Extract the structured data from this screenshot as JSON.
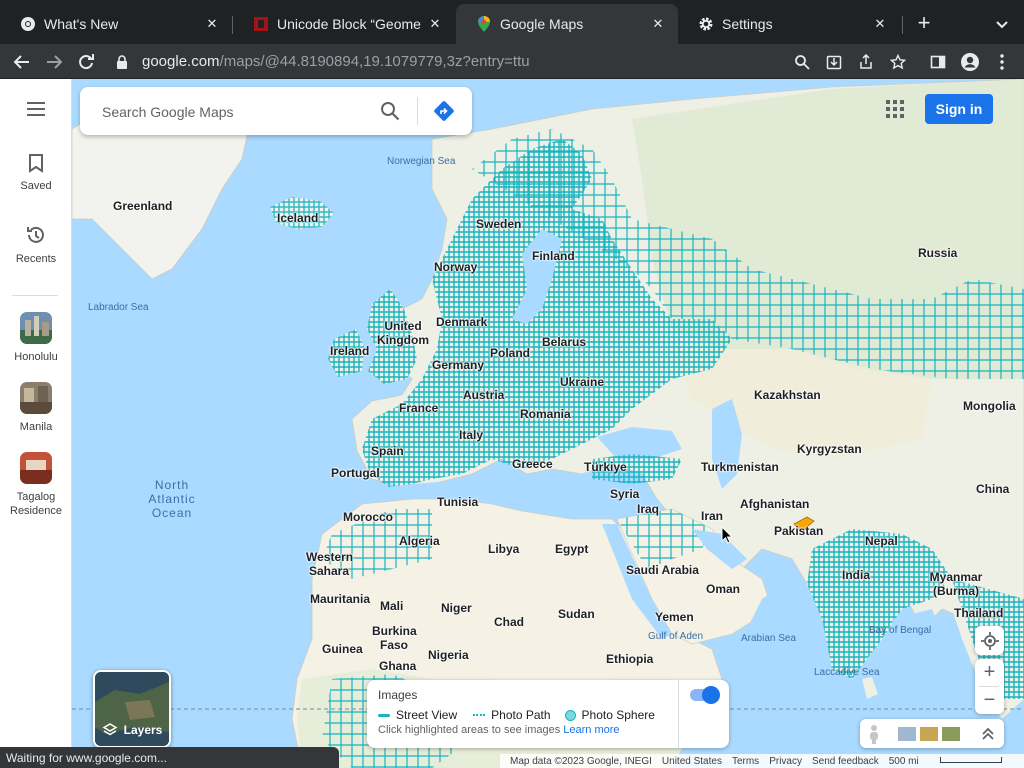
{
  "browser": {
    "tabs": [
      {
        "title": "What's New",
        "icon": "chrome-icon"
      },
      {
        "title": "Unicode Block “Geometric S",
        "icon": "unicode-site-icon"
      },
      {
        "title": "Google Maps",
        "icon": "google-maps-icon"
      },
      {
        "title": "Settings",
        "icon": "gear-icon"
      }
    ],
    "active_tab": 2,
    "url_host": "google.com",
    "url_path": "/maps/@44.8190894,19.1079779,3z?entry=ttu",
    "status_text": "Waiting for www.google.com..."
  },
  "rail": {
    "saved_label": "Saved",
    "recents_label": "Recents",
    "places": [
      {
        "label": "Honolulu"
      },
      {
        "label": "Manila"
      },
      {
        "label": "Tagalog Residence"
      }
    ]
  },
  "search": {
    "placeholder": "Search Google Maps"
  },
  "header": {
    "sign_in": "Sign in"
  },
  "map": {
    "labels": [
      {
        "text": "Greenland"
      },
      {
        "text": "Iceland"
      },
      {
        "text": "Sweden"
      },
      {
        "text": "Finland"
      },
      {
        "text": "Norway"
      },
      {
        "text": "Russia"
      },
      {
        "text": "Denmark"
      },
      {
        "text": "United Kingdom"
      },
      {
        "text": "Ireland"
      },
      {
        "text": "Poland"
      },
      {
        "text": "Belarus"
      },
      {
        "text": "Germany"
      },
      {
        "text": "Ukraine"
      },
      {
        "text": "France"
      },
      {
        "text": "Austria"
      },
      {
        "text": "Kazakhstan"
      },
      {
        "text": "Mongolia"
      },
      {
        "text": "Romania"
      },
      {
        "text": "Spain"
      },
      {
        "text": "Italy"
      },
      {
        "text": "Kyrgyzstan"
      },
      {
        "text": "Portugal"
      },
      {
        "text": "Greece"
      },
      {
        "text": "Türkiye"
      },
      {
        "text": "Turkmenistan"
      },
      {
        "text": "China"
      },
      {
        "text": "Tunisia"
      },
      {
        "text": "Syria"
      },
      {
        "text": "Afghanistan"
      },
      {
        "text": "Morocco"
      },
      {
        "text": "Iraq"
      },
      {
        "text": "Iran"
      },
      {
        "text": "Pakistan"
      },
      {
        "text": "Algeria"
      },
      {
        "text": "Libya"
      },
      {
        "text": "Egypt"
      },
      {
        "text": "Nepal"
      },
      {
        "text": "Western Sahara"
      },
      {
        "text": "Saudi Arabia"
      },
      {
        "text": "India"
      },
      {
        "text": "Myanmar (Burma)"
      },
      {
        "text": "Oman"
      },
      {
        "text": "Mauritania"
      },
      {
        "text": "Mali"
      },
      {
        "text": "Niger"
      },
      {
        "text": "Sudan"
      },
      {
        "text": "Yemen"
      },
      {
        "text": "Thailand"
      },
      {
        "text": "Chad"
      },
      {
        "text": "Burkina Faso"
      },
      {
        "text": "Guinea"
      },
      {
        "text": "Nigeria"
      },
      {
        "text": "Ethiopia"
      },
      {
        "text": "Ghana"
      }
    ],
    "seas": [
      {
        "text": "Norwegian Sea"
      },
      {
        "text": "Labrador Sea"
      },
      {
        "text": "Gulf of Aden"
      },
      {
        "text": "Arabian Sea"
      },
      {
        "text": "Bay of Bengal"
      },
      {
        "text": "Laccadive Sea"
      }
    ],
    "ocean": "North Atlantic Ocean"
  },
  "layers": {
    "label": "Layers"
  },
  "images_panel": {
    "title": "Images",
    "legend": [
      {
        "label": "Street View"
      },
      {
        "label": "Photo Path"
      },
      {
        "label": "Photo Sphere"
      }
    ],
    "hint": "Click highlighted areas to see images",
    "learn_more": "Learn more",
    "toggle_on": true
  },
  "footer": {
    "map_data": "Map data ©2023 Google, INEGI",
    "country": "United States",
    "terms": "Terms",
    "privacy": "Privacy",
    "feedback": "Send feedback",
    "scale": "500 mi"
  },
  "colors": {
    "coverage": "#19b3c0",
    "accent": "#1a73e8",
    "water": "#aadaff",
    "land": "#eef0e5"
  }
}
